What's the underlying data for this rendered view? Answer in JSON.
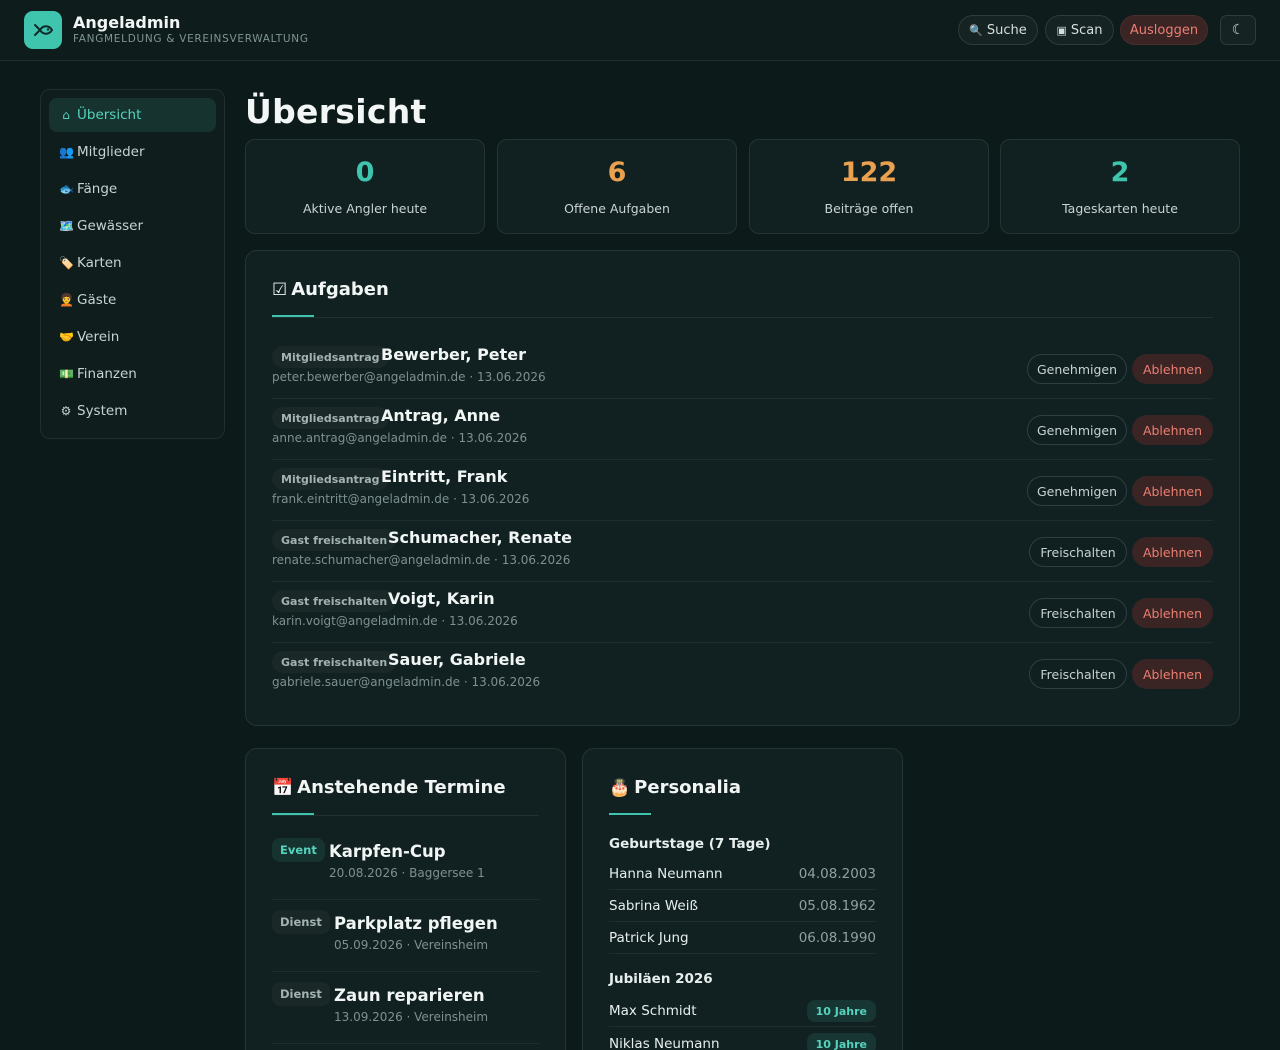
{
  "header": {
    "title": "Angeladmin",
    "subtitle": "Fangmeldung & Vereinsverwaltung",
    "search_label": "Suche",
    "scan_label": "Scan",
    "logout_label": "Ausloggen",
    "theme_icon": "moon-icon"
  },
  "sidebar": {
    "items": [
      {
        "label": "Übersicht",
        "icon": "home-icon",
        "glyph": "⌂",
        "active": true
      },
      {
        "label": "Mitglieder",
        "icon": "members-icon",
        "glyph": "👥"
      },
      {
        "label": "Fänge",
        "icon": "fish-icon",
        "glyph": "🐟"
      },
      {
        "label": "Gewässer",
        "icon": "map-icon",
        "glyph": "🗺️"
      },
      {
        "label": "Karten",
        "icon": "tag-icon",
        "glyph": "🏷️"
      },
      {
        "label": "Gäste",
        "icon": "guest-icon",
        "glyph": "🧑‍🦱"
      },
      {
        "label": "Verein",
        "icon": "handshake-icon",
        "glyph": "🤝"
      },
      {
        "label": "Finanzen",
        "icon": "money-icon",
        "glyph": "💵"
      },
      {
        "label": "System",
        "icon": "gear-icon",
        "glyph": "⚙"
      }
    ]
  },
  "main": {
    "title": "Übersicht",
    "stats": [
      {
        "value": "0",
        "label": "Aktive Angler heute",
        "color": "#3fc4ad"
      },
      {
        "value": "6",
        "label": "Offene Aufgaben",
        "color": "#eaa14f"
      },
      {
        "value": "122",
        "label": "Beiträge offen",
        "color": "#eaa14f"
      },
      {
        "value": "2",
        "label": "Tageskarten heute",
        "color": "#3fc4ad"
      }
    ],
    "tasks": {
      "title": "Aufgaben",
      "items": [
        {
          "type": "Mitgliedsantrag",
          "name": "Bewerber, Peter",
          "meta": "peter.bewerber@angeladmin.de · 13.06.2026",
          "approve": "Genehmigen",
          "reject": "Ablehnen"
        },
        {
          "type": "Mitgliedsantrag",
          "name": "Antrag, Anne",
          "meta": "anne.antrag@angeladmin.de · 13.06.2026",
          "approve": "Genehmigen",
          "reject": "Ablehnen"
        },
        {
          "type": "Mitgliedsantrag",
          "name": "Eintritt, Frank",
          "meta": "frank.eintritt@angeladmin.de · 13.06.2026",
          "approve": "Genehmigen",
          "reject": "Ablehnen"
        },
        {
          "type": "Gast freischalten",
          "name": "Schumacher, Renate",
          "meta": "renate.schumacher@angeladmin.de · 13.06.2026",
          "approve": "Freischalten",
          "reject": "Ablehnen"
        },
        {
          "type": "Gast freischalten",
          "name": "Voigt, Karin",
          "meta": "karin.voigt@angeladmin.de · 13.06.2026",
          "approve": "Freischalten",
          "reject": "Ablehnen"
        },
        {
          "type": "Gast freischalten",
          "name": "Sauer, Gabriele",
          "meta": "gabriele.sauer@angeladmin.de · 13.06.2026",
          "approve": "Freischalten",
          "reject": "Ablehnen"
        }
      ]
    },
    "events": {
      "title": "Anstehende Termine",
      "items": [
        {
          "tag": "Event",
          "kind": "event",
          "title": "Karpfen-Cup",
          "meta": "20.08.2026 · Baggersee 1"
        },
        {
          "tag": "Dienst",
          "kind": "dienst",
          "title": "Parkplatz pflegen",
          "meta": "05.09.2026 · Vereinsheim"
        },
        {
          "tag": "Dienst",
          "kind": "dienst",
          "title": "Zaun reparieren",
          "meta": "13.09.2026 · Vereinsheim"
        }
      ]
    },
    "personalia": {
      "title": "Personalia",
      "birthdays_title": "Geburtstage (7 Tage)",
      "birthdays": [
        {
          "name": "Hanna Neumann",
          "date": "04.08.2003"
        },
        {
          "name": "Sabrina Weiß",
          "date": "05.08.1962"
        },
        {
          "name": "Patrick Jung",
          "date": "06.08.1990"
        }
      ],
      "jubilees_title": "Jubiläen 2026",
      "jubilees": [
        {
          "name": "Max Schmidt",
          "badge": "10 Jahre"
        },
        {
          "name": "Niklas Neumann",
          "badge": "10 Jahre"
        }
      ]
    }
  }
}
